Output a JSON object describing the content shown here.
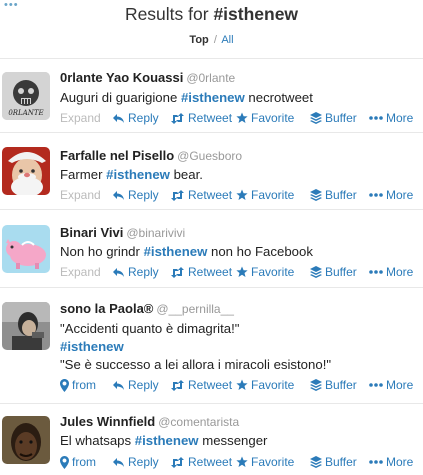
{
  "header": {
    "dots": "•••",
    "title_prefix": "Results for ",
    "title_query": "#isthenew",
    "filter_top": "Top",
    "filter_sep": "/",
    "filter_all": "All"
  },
  "actions": {
    "expand": "Expand",
    "from": "from",
    "reply": "Reply",
    "retweet": "Retweet",
    "favorite": "Favorite",
    "buffer": "Buffer",
    "more": "More"
  },
  "tweets": [
    {
      "name": "0rlante Yao Kouassi",
      "handle": "@0rlante",
      "avatar_label": "0RLANTE",
      "text1_a": "Auguri di guarigione ",
      "text1_tag": "#isthenew",
      "text1_b": " necrotweet"
    },
    {
      "name": "Farfalle nel Pisello",
      "handle": "@Guesboro",
      "text1_a": "Farmer ",
      "text1_tag": "#isthenew",
      "text1_b": " bear."
    },
    {
      "name": "Binari Vivi",
      "handle": "@binarivivi",
      "text1_a": "Non ho grindr ",
      "text1_tag": "#isthenew",
      "text1_b": " non ho Facebook"
    },
    {
      "name": "sono la Paola®",
      "handle": "@__pernilla__",
      "line1": "\"Accidenti quanto è dimagrita!\"",
      "line2_tag": "#isthenew",
      "line3": "\"Se è successo a lei allora i miracoli esistono!\""
    },
    {
      "name": "Jules Winnfield",
      "handle": "@comentarista",
      "text1_a": "El whatsaps ",
      "text1_tag": "#isthenew",
      "text1_b": " messenger"
    }
  ],
  "colors": {
    "link": "#2b7bb9",
    "muted": "#999999",
    "divider": "#e8e8e8"
  }
}
